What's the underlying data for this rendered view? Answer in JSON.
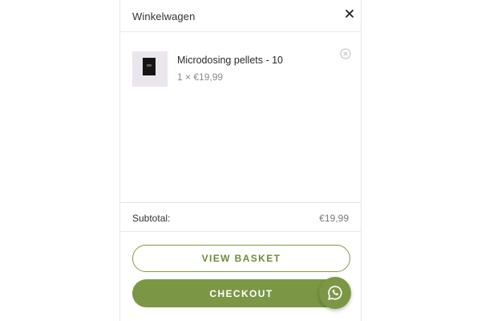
{
  "cart": {
    "title": "Winkelwagen",
    "items": [
      {
        "name": "Microdosing pellets - 10",
        "quantity_price": "1 × €19,99"
      }
    ],
    "subtotal_label": "Subtotal:",
    "subtotal_value": "€19,99",
    "view_basket_label": "VIEW BASKET",
    "checkout_label": "CHECKOUT"
  },
  "icons": {
    "close": "close-icon",
    "remove": "remove-circle-icon",
    "whatsapp": "whatsapp-icon"
  },
  "colors": {
    "brand_green": "#7b9746",
    "text_dark": "#333333",
    "text_muted": "#8a8a8a"
  }
}
